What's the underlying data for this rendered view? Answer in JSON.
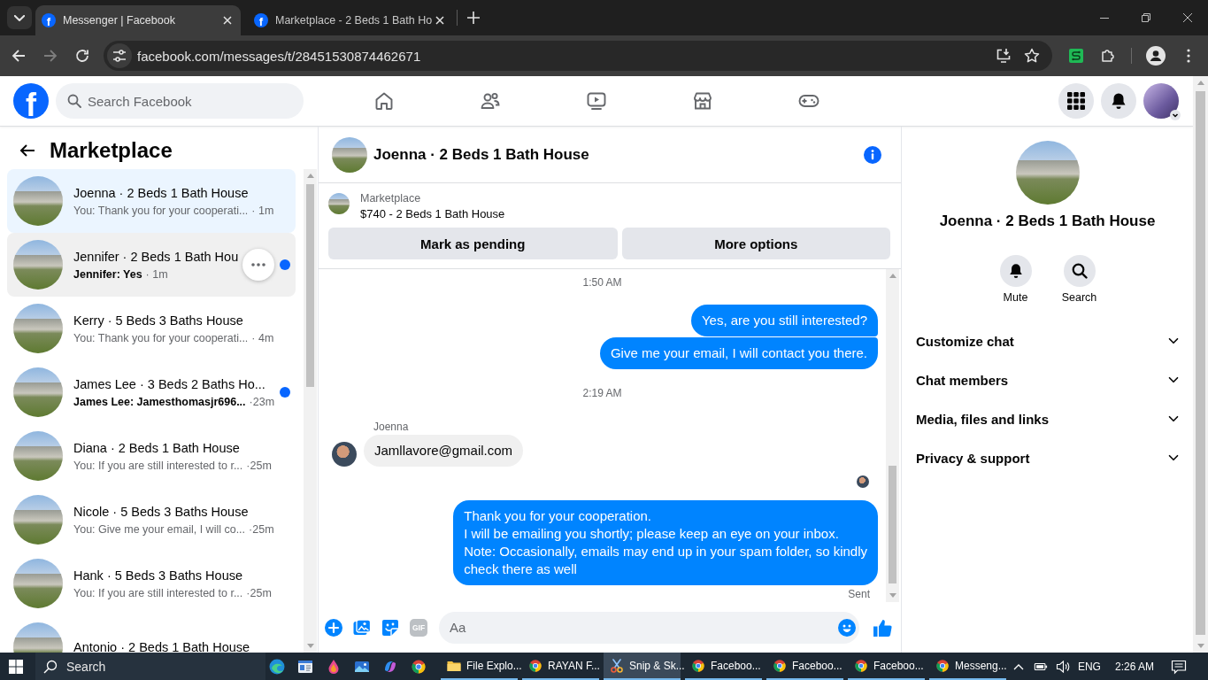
{
  "browser": {
    "tabs": [
      {
        "favicon": "f",
        "title": "Messenger | Facebook",
        "selected": true
      },
      {
        "favicon": "f",
        "title": "Marketplace - 2 Beds 1 Bath Ho",
        "selected": false
      }
    ],
    "url": "facebook.com/messages/t/28451530874462671"
  },
  "header": {
    "logo": "f",
    "search": {
      "placeholder": "Search Facebook"
    }
  },
  "sidebar": {
    "title": "Marketplace",
    "conversations": [
      {
        "name": "Joenna · 2 Beds 1 Bath House",
        "preview": "You: Thank you for your cooperati...",
        "time": "· 1m",
        "selected": true,
        "hovered": false,
        "unread": false
      },
      {
        "name": "Jennifer · 2 Beds 1 Bath Hou",
        "preview": "Jennifer: Yes",
        "time": "· 1m",
        "selected": false,
        "hovered": true,
        "unread": true
      },
      {
        "name": "Kerry · 5 Beds 3 Baths House",
        "preview": "You: Thank you for your cooperati...",
        "time": "· 4m",
        "selected": false,
        "hovered": false,
        "unread": false
      },
      {
        "name": "James Lee · 3 Beds 2 Baths Ho...",
        "preview": "James Lee: Jamesthomasjr696...",
        "time": "·23m",
        "selected": false,
        "hovered": false,
        "unread": true
      },
      {
        "name": "Diana · 2 Beds 1 Bath House",
        "preview": "You: If you are still interested to r...",
        "time": "·25m",
        "selected": false,
        "hovered": false,
        "unread": false
      },
      {
        "name": "Nicole · 5 Beds 3 Baths House",
        "preview": "You: Give me your email, I will co...",
        "time": "·25m",
        "selected": false,
        "hovered": false,
        "unread": false
      },
      {
        "name": "Hank · 5 Beds 3 Baths House",
        "preview": "You: If you are still interested to r...",
        "time": "·25m",
        "selected": false,
        "hovered": false,
        "unread": false
      },
      {
        "name": "Antonio · 2 Beds 1 Bath House",
        "selected": false,
        "hovered": false,
        "unread": false
      }
    ]
  },
  "chat": {
    "title": "Joenna · 2 Beds 1 Bath House",
    "listing": {
      "source": "Marketplace",
      "title": "$740 - 2 Beds 1 Bath House"
    },
    "actions": [
      "Mark as pending",
      "More options"
    ],
    "messages": [
      {
        "kind": "timestamp",
        "text": "1:50 AM"
      },
      {
        "kind": "outgoing",
        "text": "Yes, are you still interested?"
      },
      {
        "kind": "outgoing",
        "text": "Give me your email, I will contact you there."
      },
      {
        "kind": "timestamp",
        "text": "2:19 AM"
      },
      {
        "kind": "incoming",
        "sender": "Joenna",
        "text": "Jamllavore@gmail.com"
      },
      {
        "kind": "seen"
      },
      {
        "kind": "outgoing",
        "text": "Thank you for your cooperation.\nI will be emailing you shortly; please keep an eye on your inbox.\nNote: Occasionally, emails may end up in your spam folder, so kindly\ncheck there as well"
      },
      {
        "kind": "status",
        "text": "Sent"
      }
    ],
    "composer": {
      "gif": "GIF",
      "placeholder": "Aa"
    }
  },
  "details": {
    "name": "Joenna · 2 Beds 1 Bath House",
    "actions": [
      {
        "kind": "mute",
        "label": "Mute"
      },
      {
        "kind": "search",
        "label": "Search"
      }
    ],
    "sections": [
      {
        "label": "Customize chat",
        "expanded": false
      },
      {
        "label": "Chat members",
        "expanded": false
      },
      {
        "label": "Media, files and links",
        "expanded": false
      },
      {
        "label": "Privacy & support",
        "expanded": false
      }
    ]
  },
  "taskbar": {
    "search": {
      "placeholder": "Search"
    },
    "apps": [
      {
        "kind": "folder",
        "label": "File Explo...",
        "selected": false
      },
      {
        "kind": "browser",
        "label": "RAYAN F...",
        "selected": false
      },
      {
        "kind": "snip",
        "label": "Snip & Sk...",
        "selected": true
      },
      {
        "kind": "browser",
        "label": "Faceboo...",
        "selected": false
      },
      {
        "kind": "browser",
        "label": "Faceboo...",
        "selected": false
      },
      {
        "kind": "browser",
        "label": "Faceboo...",
        "selected": false
      },
      {
        "kind": "browser",
        "label": "Messeng...",
        "selected": false
      }
    ],
    "language": "ENG",
    "time": "2:26 AM"
  }
}
